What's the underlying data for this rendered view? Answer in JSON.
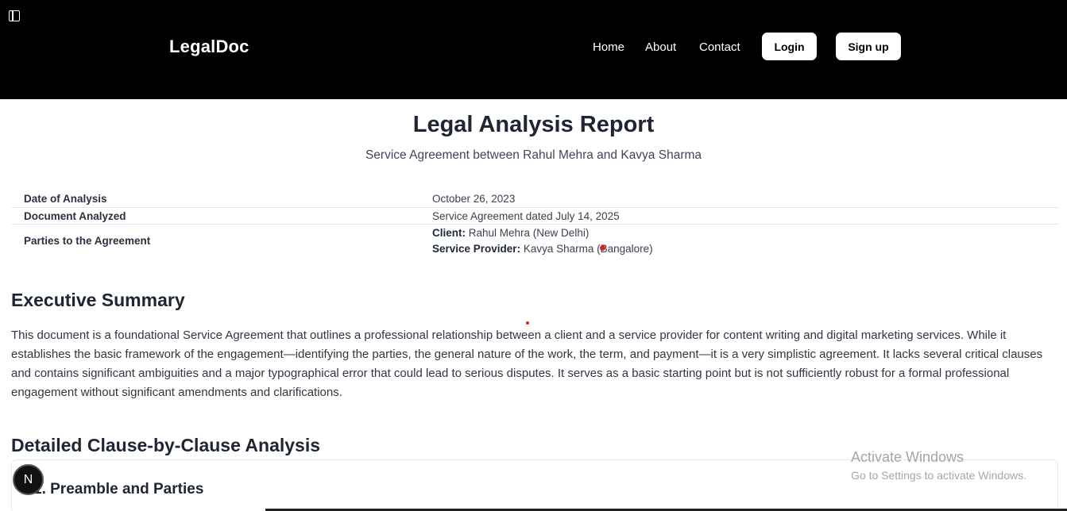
{
  "header": {
    "brand": "LegalDoc",
    "nav": [
      "Home",
      "About",
      "Contact"
    ],
    "login_label": "Login",
    "signup_label": "Sign up"
  },
  "report": {
    "title": "Legal Analysis Report",
    "subtitle": "Service Agreement between Rahul Mehra and Kavya Sharma",
    "meta": [
      {
        "label": "Date of Analysis",
        "value": "October 26, 2023"
      },
      {
        "label": "Document Analyzed",
        "value": "Service Agreement dated July 14, 2025"
      },
      {
        "label": "Parties to the Agreement",
        "client_label": "Client:",
        "client_value": "Rahul Mehra (New Delhi)",
        "provider_label": "Service Provider:",
        "provider_value": "Kavya Sharma (Bangalore)"
      }
    ]
  },
  "executive_summary": {
    "heading": "Executive Summary",
    "text": "This document is a foundational Service Agreement that outlines a professional relationship between a client and a service provider for content writing and digital marketing services. While it establishes the basic framework of the engagement—identifying the parties, the general nature of the work, the term, and payment—it is a very simplistic agreement. It lacks several critical clauses and contains significant ambiguities and a major typographical error that could lead to serious disputes. It serves as a basic starting point but is not sufficiently robust for a formal professional engagement without significant amendments and clarifications."
  },
  "clause_analysis": {
    "heading": "Detailed Clause-by-Clause Analysis",
    "first_clause": "1. Preamble and Parties"
  },
  "badge_letter": "N",
  "os_watermark": {
    "title": "Activate Windows",
    "subtitle": "Go to Settings to activate Windows."
  },
  "icons": {
    "sidebar_toggle": "sidebar-toggle-icon"
  },
  "colors": {
    "header_bg": "#000000",
    "page_bg": "#ffffff",
    "text_dark": "#1e2533"
  }
}
